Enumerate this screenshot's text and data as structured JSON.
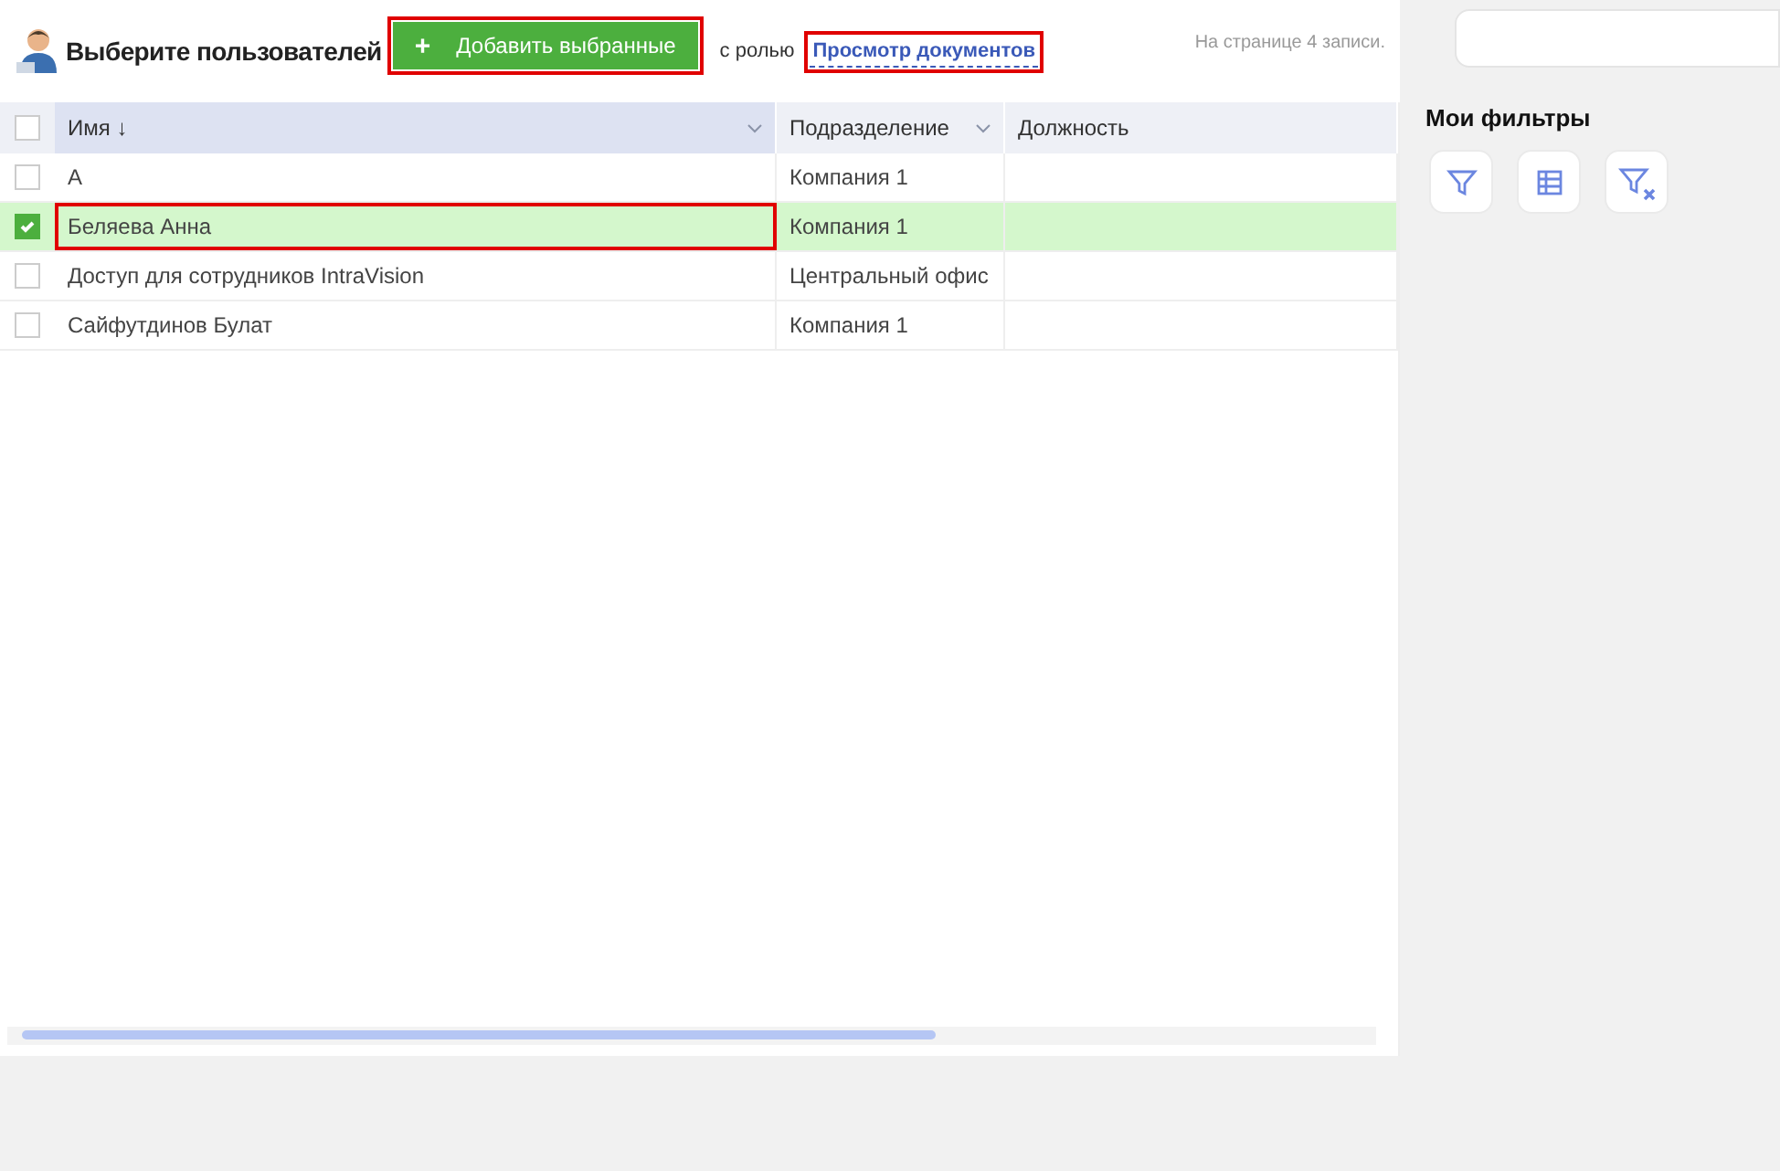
{
  "header": {
    "title": "Выберите пользователей",
    "add_button": "Добавить выбранные",
    "add_icon": "+",
    "role_prefix": "с ролью",
    "role_link": "Просмотр документов",
    "page_info": "На странице 4 записи."
  },
  "table": {
    "all_checked": false,
    "columns": [
      {
        "label": "Имя ↓",
        "sorted": true
      },
      {
        "label": "Подразделение",
        "sorted": false
      },
      {
        "label": "Должность",
        "sorted": false
      }
    ],
    "rows": [
      {
        "name": "А",
        "department": "Компания 1",
        "selected": false
      },
      {
        "name": "Беляева Анна",
        "department": "Компания 1",
        "selected": true
      },
      {
        "name": "Доступ для сотрудников IntraVision",
        "department": "Центральный офис",
        "selected": false
      },
      {
        "name": "Сайфутдинов Булат",
        "department": "Компания 1",
        "selected": false
      }
    ]
  },
  "filters": {
    "title": "Мои фильтры",
    "buttons": [
      {
        "kind": "filter"
      },
      {
        "kind": "table"
      },
      {
        "kind": "clear"
      }
    ]
  }
}
